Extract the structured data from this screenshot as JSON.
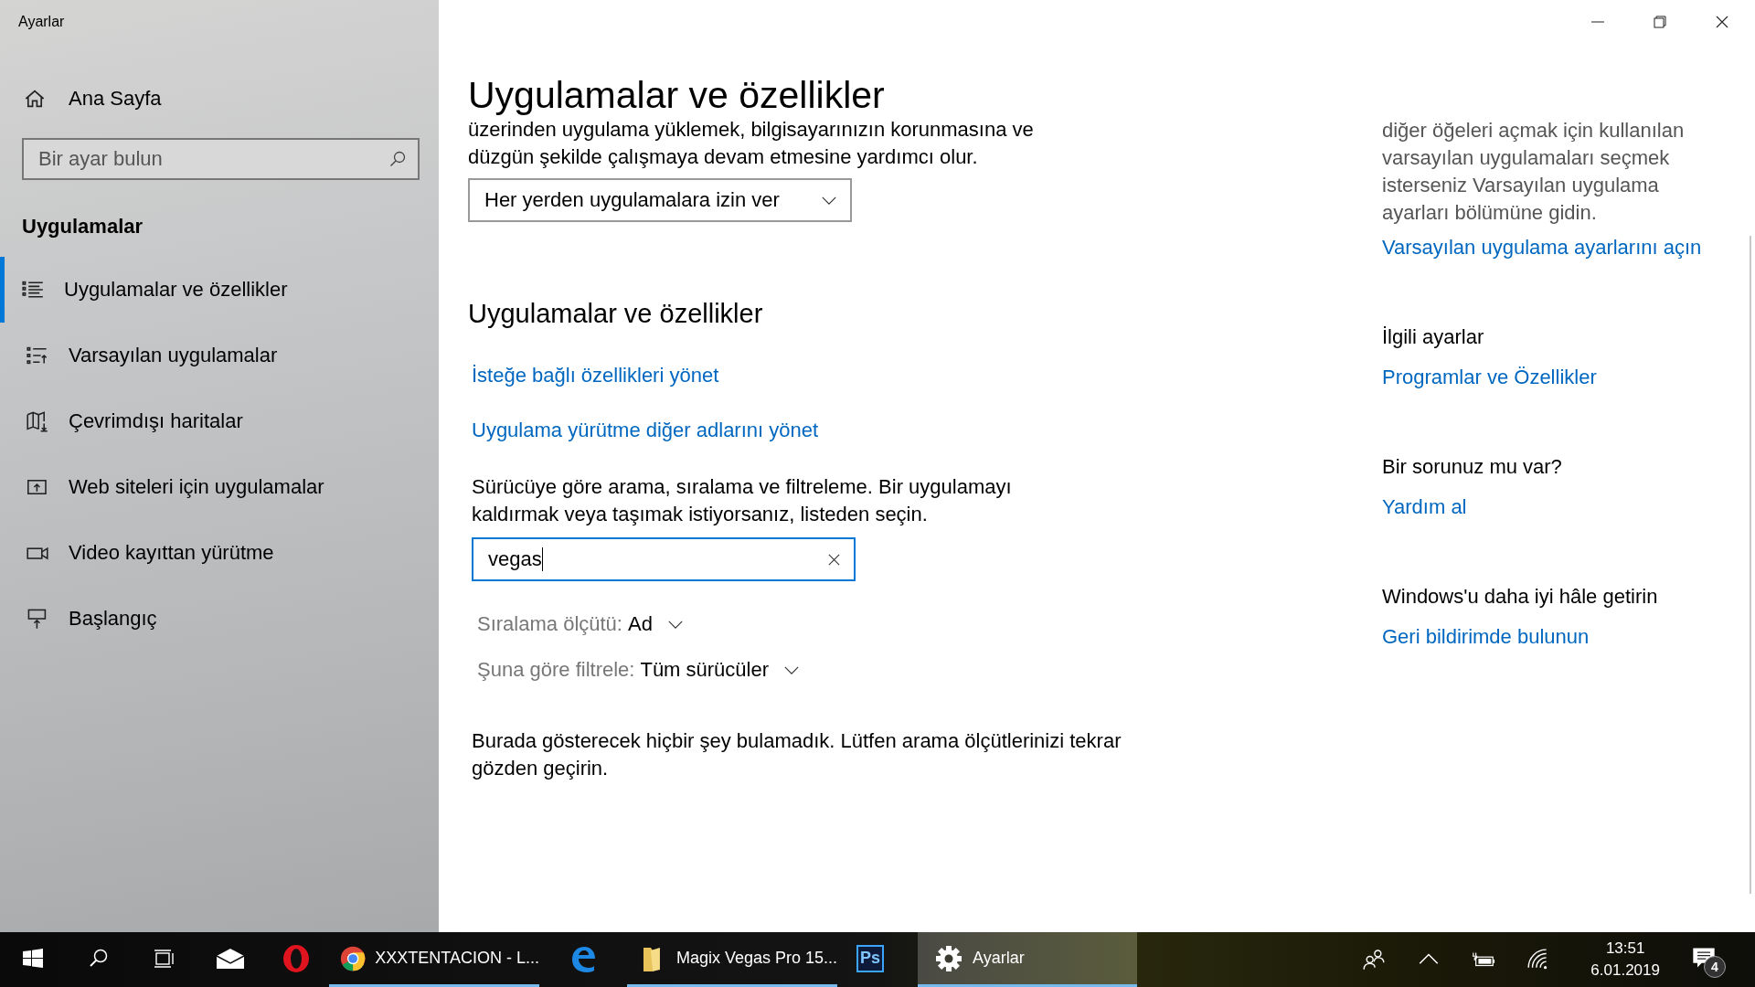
{
  "window": {
    "title": "Ayarlar"
  },
  "sidebar": {
    "home": "Ana Sayfa",
    "search": {
      "placeholder": "Bir ayar bulun"
    },
    "section": "Uygulamalar",
    "items": [
      {
        "label": "Uygulamalar ve özellikler",
        "selected": true
      },
      {
        "label": "Varsayılan uygulamalar",
        "selected": false
      },
      {
        "label": "Çevrimdışı haritalar",
        "selected": false
      },
      {
        "label": "Web siteleri için uygulamalar",
        "selected": false
      },
      {
        "label": "Video kayıttan yürütme",
        "selected": false
      },
      {
        "label": "Başlangıç",
        "selected": false
      }
    ]
  },
  "main": {
    "title": "Uygulamalar ve özellikler",
    "intro": "üzerinden uygulama yüklemek, bilgisayarınızın korunmasına ve düzgün şekilde çalışmaya devam etmesine yardımcı olur.",
    "install_dropdown": {
      "value": "Her yerden uygulamalara izin ver"
    },
    "section_title": "Uygulamalar ve özellikler",
    "links": [
      "İsteğe bağlı özellikleri yönet",
      "Uygulama yürütme diğer adlarını yönet"
    ],
    "description": "Sürücüye göre arama, sıralama ve filtreleme. Bir uygulamayı kaldırmak veya taşımak istiyorsanız, listeden seçin.",
    "search": {
      "value": "vegas",
      "focused": true
    },
    "sort": {
      "label": "Sıralama ölçütü:",
      "value": "Ad"
    },
    "filter": {
      "label": "Şuna göre filtrele:",
      "value": "Tüm sürücüler"
    },
    "message": "Burada gösterecek hiçbir şey bulamadık. Lütfen arama ölçütlerinizi tekrar gözden geçirin."
  },
  "right": {
    "note": "diğer öğeleri açmak için kullanılan varsayılan uygulamaları seçmek isterseniz Varsayılan uygulama ayarları bölümüne gidin.",
    "note_link": "Varsayılan uygulama ayarlarını açın",
    "groups": [
      {
        "heading": "İlgili ayarlar",
        "link": "Programlar ve Özellikler"
      },
      {
        "heading": "Bir sorunuz mu var?",
        "link": "Yardım al"
      },
      {
        "heading": "Windows'u daha iyi hâle getirin",
        "link": "Geri bildirimde bulunun"
      }
    ]
  },
  "taskbar": {
    "items": [
      {
        "kind": "start",
        "running": false,
        "active": false
      },
      {
        "kind": "search",
        "running": false,
        "active": false
      },
      {
        "kind": "taskview",
        "running": false,
        "active": false
      },
      {
        "kind": "mail",
        "running": false,
        "active": false
      },
      {
        "kind": "opera",
        "running": false,
        "active": false
      },
      {
        "kind": "chrome",
        "label": "XXXTENTACION - L...",
        "running": true,
        "active": false
      },
      {
        "kind": "edge",
        "running": false,
        "active": false
      },
      {
        "kind": "folder",
        "label": "Magix Vegas Pro 15...",
        "running": true,
        "active": false
      },
      {
        "kind": "photoshop",
        "glyph": "Ps",
        "running": false,
        "active": false
      },
      {
        "kind": "settings",
        "label": "Ayarlar",
        "running": true,
        "active": true
      }
    ],
    "time": "13:51",
    "date": "6.01.2019",
    "notifications": "4"
  }
}
